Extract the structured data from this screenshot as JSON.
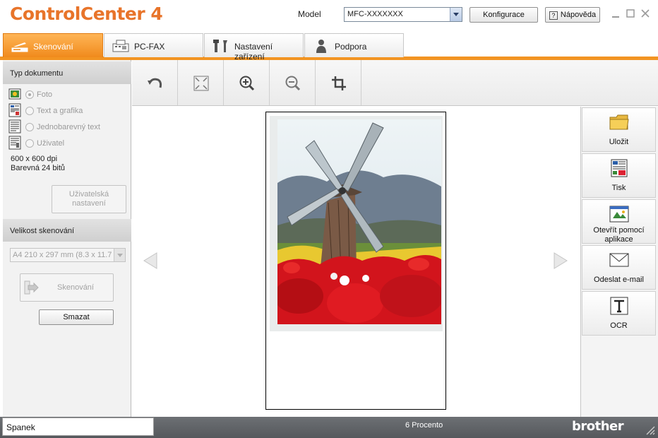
{
  "window": {
    "title_main": "ControlCenter",
    "title_num": "4",
    "model_label": "Model",
    "model_value": "MFC-XXXXXXX",
    "config_label": "Konfigurace",
    "help_label": "Nápověda",
    "help_glyph": "?"
  },
  "tabs": [
    {
      "label": "Skenování"
    },
    {
      "label": "PC-FAX"
    },
    {
      "label": "Nastavení zařízení"
    },
    {
      "label": "Podpora"
    }
  ],
  "left": {
    "doc_type_header": "Typ dokumentu",
    "options": [
      {
        "label": "Foto",
        "selected": true
      },
      {
        "label": "Text a grafika",
        "selected": false
      },
      {
        "label": "Jednobarevný text",
        "selected": false
      },
      {
        "label": "Uživatel",
        "selected": false
      }
    ],
    "resolution": "600 x 600 dpi",
    "color_depth": "Barevná 24 bitů",
    "user_settings_line1": "Uživatelská",
    "user_settings_line2": "nastavení",
    "scan_size_header": "Velikost skenování",
    "scan_size_value": "A4 210 x 297 mm (8.3 x 11.7",
    "scan_label": "Skenování",
    "clear_label": "Smazat"
  },
  "actions": [
    {
      "label": "Uložit"
    },
    {
      "label": "Tisk"
    },
    {
      "label": "Otevřít pomocí aplikace"
    },
    {
      "label": "Odeslat e-mail"
    },
    {
      "label": "OCR"
    }
  ],
  "status": {
    "state": "Spanek",
    "zoom": "6 Procento",
    "brand": "brother"
  },
  "colors": {
    "accent": "#f29422",
    "title": "#e8742a",
    "statusbar": "#5f6266"
  }
}
